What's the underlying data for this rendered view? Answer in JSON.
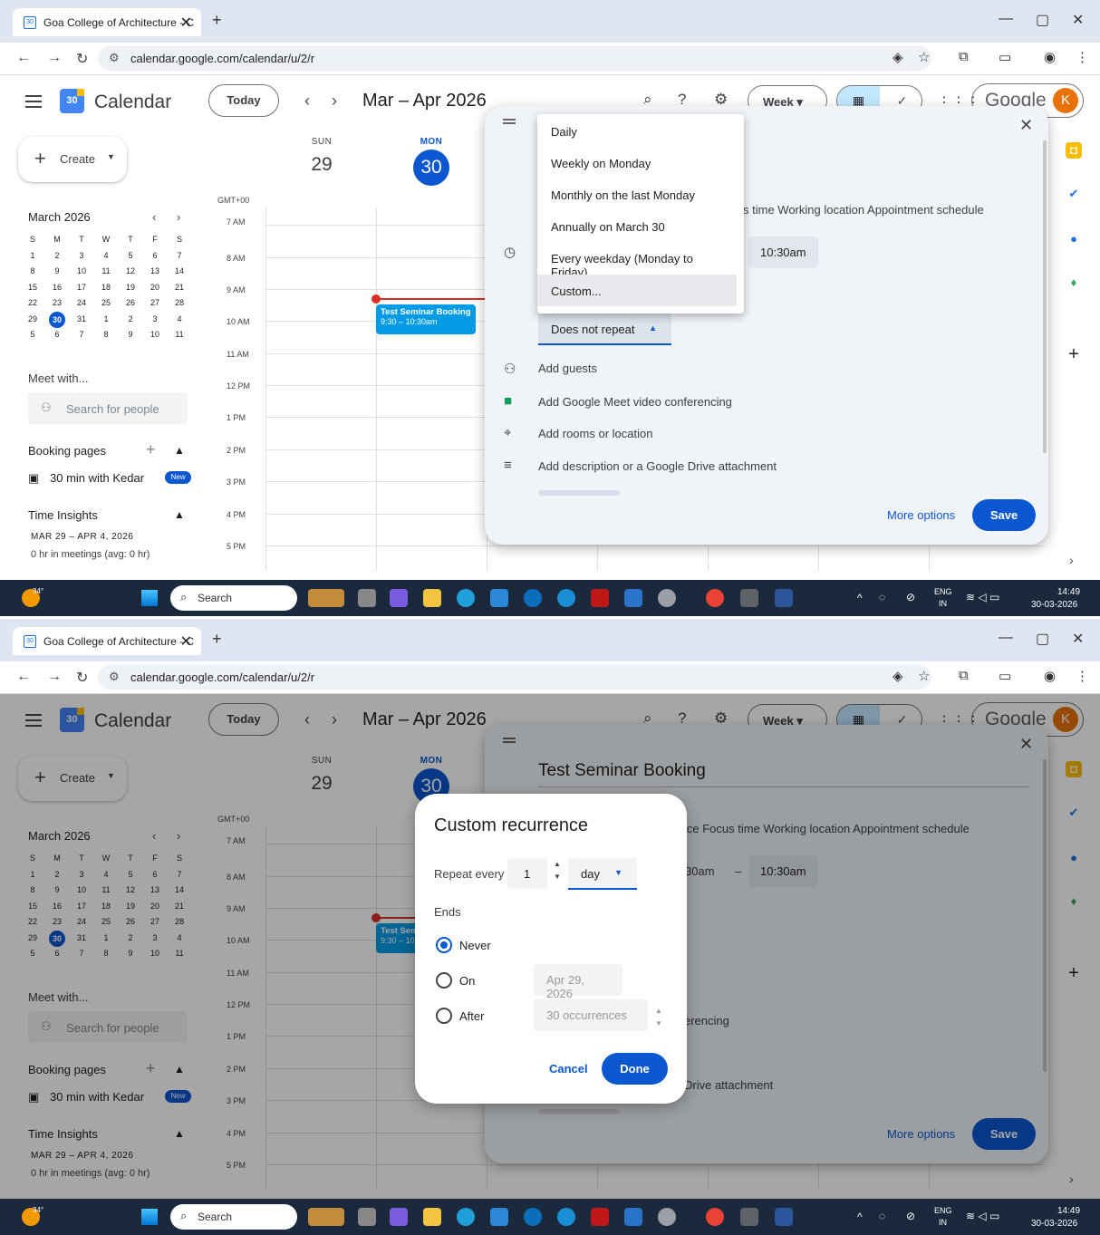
{
  "browser": {
    "tab_title": "Goa College of Architecture - C",
    "tab_favicon": "30",
    "tab_close": "✕",
    "new_tab": "+",
    "url": "calendar.google.com/calendar/u/2/r",
    "window_controls": [
      "—",
      "▢",
      "✕"
    ]
  },
  "header": {
    "app_name": "Calendar",
    "logo_text": "30",
    "today": "Today",
    "range": "Mar – Apr 2026",
    "view": "Week",
    "google": "Google",
    "avatar": "K"
  },
  "sidebar": {
    "create": "Create",
    "mini_title": "March 2026",
    "weekdays": [
      "S",
      "M",
      "T",
      "W",
      "T",
      "F",
      "S"
    ],
    "weeks": [
      [
        "1",
        "2",
        "3",
        "4",
        "5",
        "6",
        "7"
      ],
      [
        "8",
        "9",
        "10",
        "11",
        "12",
        "13",
        "14"
      ],
      [
        "15",
        "16",
        "17",
        "18",
        "19",
        "20",
        "21"
      ],
      [
        "22",
        "23",
        "24",
        "25",
        "26",
        "27",
        "28"
      ],
      [
        "29",
        "30",
        "31",
        "1",
        "2",
        "3",
        "4"
      ],
      [
        "5",
        "6",
        "7",
        "8",
        "9",
        "10",
        "11"
      ]
    ],
    "today_date": "30",
    "meet_with": "Meet with...",
    "search_people": "Search for people",
    "booking_pages": "Booking pages",
    "booking_item": "30 min with Kedar",
    "new_badge": "New",
    "time_insights": "Time Insights",
    "insights_range": "MAR 29 – APR 4, 2026",
    "insights_sub": "0 hr in meetings (avg: 0 hr)"
  },
  "grid": {
    "days": [
      {
        "name": "SUN",
        "date": "29"
      },
      {
        "name": "MON",
        "date": "30"
      }
    ],
    "timezone": "GMT+00",
    "hours": [
      "7 AM",
      "8 AM",
      "9 AM",
      "10 AM",
      "11 AM",
      "12 PM",
      "1 PM",
      "2 PM",
      "3 PM",
      "4 PM",
      "5 PM"
    ],
    "event_title": "Test Seminar Booking",
    "event_time": "9:30 – 10:30am"
  },
  "quick_event": {
    "title": "Test Seminar Booking",
    "type_tabs_s1": "s time    Working location    Appointment schedule",
    "type_tabs_s2": "ice    Focus time    Working location    Appointment schedule",
    "end_time": "10:30am",
    "start_time_partial": "30am",
    "dash": "–",
    "repeat": "Does not repeat",
    "add_guests": "Add guests",
    "meet": "Add Google Meet video conferencing",
    "meet_partial": "erencing",
    "location": "Add rooms or location",
    "description": "Add description or a Google Drive attachment",
    "description_partial": "Drive attachment",
    "more_options": "More options",
    "save": "Save"
  },
  "repeat_menu": [
    "Daily",
    "Weekly on Monday",
    "Monthly on the last Monday",
    "Annually on March 30",
    "Every weekday (Monday to Friday)",
    "Custom..."
  ],
  "custom_recurrence": {
    "title": "Custom recurrence",
    "repeat_every_label": "Repeat every",
    "repeat_count": "1",
    "repeat_unit": "day",
    "ends_label": "Ends",
    "never": "Never",
    "on": "On",
    "on_date": "Apr 29, 2026",
    "after": "After",
    "occurrences": "30   occurrences",
    "cancel": "Cancel",
    "done": "Done"
  },
  "taskbar": {
    "temp": "34°",
    "search": "Search",
    "lang": "ENG",
    "region": "IN",
    "time": "14:49",
    "date": "30-03-2026"
  },
  "icons": [
    "calendar-favicon-icon",
    "back-arrow-icon",
    "forward-arrow-icon",
    "reload-icon",
    "site-settings-icon",
    "eye-icon",
    "star-icon",
    "extensions-icon",
    "sidepanel-icon",
    "profile-icon",
    "kebab-icon",
    "hamburger-icon",
    "search-icon",
    "help-icon",
    "settings-icon",
    "calendar-view-icon",
    "tasks-view-icon",
    "apps-grid-icon",
    "plus-icon",
    "clock-icon",
    "people-icon",
    "meet-icon",
    "location-pin-icon",
    "description-icon",
    "close-icon",
    "drag-handle-icon",
    "keep-icon",
    "tasks-icon",
    "contacts-icon",
    "maps-icon",
    "windows-icon",
    "weather-icon"
  ],
  "colors": {
    "accent": "#0b57d0",
    "event": "#039be5",
    "now_line": "#d93025",
    "selected_view": "#c2e7ff"
  }
}
